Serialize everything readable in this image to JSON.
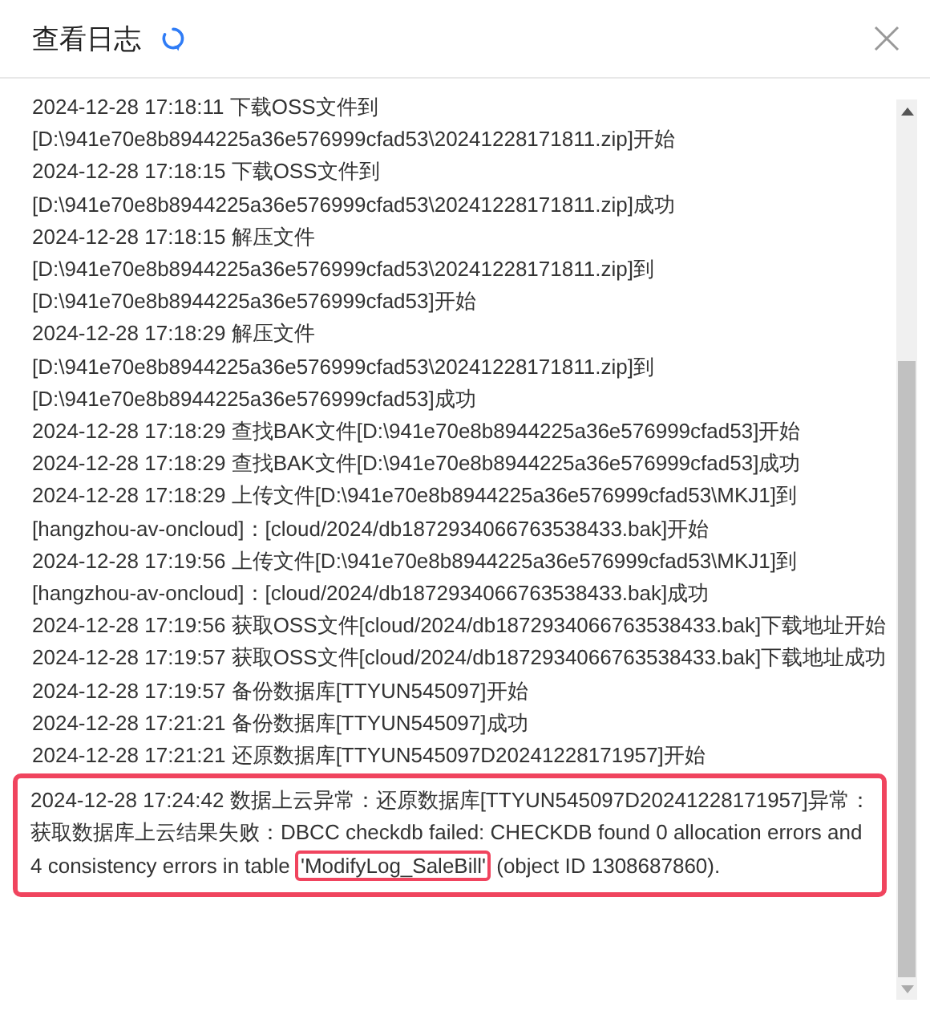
{
  "dialog": {
    "title": "查看日志",
    "loading": true
  },
  "log": [
    {
      "text": "2024-12-28 17:18:11 下载OSS文件到[D:\\941e70e8b8944225a36e576999cfad53\\20241228171811.zip]开始",
      "highlighted": false
    },
    {
      "text": "2024-12-28 17:18:15 下载OSS文件到[D:\\941e70e8b8944225a36e576999cfad53\\20241228171811.zip]成功",
      "highlighted": false
    },
    {
      "text": "2024-12-28 17:18:15 解压文件[D:\\941e70e8b8944225a36e576999cfad53\\20241228171811.zip]到[D:\\941e70e8b8944225a36e576999cfad53]开始",
      "highlighted": false
    },
    {
      "text": "2024-12-28 17:18:29 解压文件[D:\\941e70e8b8944225a36e576999cfad53\\20241228171811.zip]到[D:\\941e70e8b8944225a36e576999cfad53]成功",
      "highlighted": false
    },
    {
      "text": "2024-12-28 17:18:29 查找BAK文件[D:\\941e70e8b8944225a36e576999cfad53]开始",
      "highlighted": false
    },
    {
      "text": "2024-12-28 17:18:29 查找BAK文件[D:\\941e70e8b8944225a36e576999cfad53]成功",
      "highlighted": false
    },
    {
      "text": "2024-12-28 17:18:29 上传文件[D:\\941e70e8b8944225a36e576999cfad53\\MKJ1]到[hangzhou-av-oncloud]：[cloud/2024/db1872934066763538433.bak]开始",
      "highlighted": false
    },
    {
      "text": "2024-12-28 17:19:56 上传文件[D:\\941e70e8b8944225a36e576999cfad53\\MKJ1]到[hangzhou-av-oncloud]：[cloud/2024/db1872934066763538433.bak]成功",
      "highlighted": false
    },
    {
      "text": "2024-12-28 17:19:56 获取OSS文件[cloud/2024/db1872934066763538433.bak]下载地址开始",
      "highlighted": false
    },
    {
      "text": "2024-12-28 17:19:57 获取OSS文件[cloud/2024/db1872934066763538433.bak]下载地址成功",
      "highlighted": false
    },
    {
      "text": "2024-12-28 17:19:57 备份数据库[TTYUN545097]开始",
      "highlighted": false
    },
    {
      "text": "2024-12-28 17:21:21 备份数据库[TTYUN545097]成功",
      "highlighted": false
    },
    {
      "text": "2024-12-28 17:21:21 还原数据库[TTYUN545097D20241228171957]开始",
      "highlighted": false
    },
    {
      "highlighted": true,
      "parts": [
        {
          "text": "2024-12-28 17:24:42 数据上云异常：还原数据库[TTYUN545097D20241228171957]异常：获取数据库上云结果失败：DBCC checkdb failed: CHECKDB found 0 allocation errors and 4 consistency errors in table ",
          "boxed": false
        },
        {
          "text": "'ModifyLog_SaleBill'",
          "boxed": true
        },
        {
          "text": " (object ID 1308687860).",
          "boxed": false
        }
      ]
    }
  ]
}
